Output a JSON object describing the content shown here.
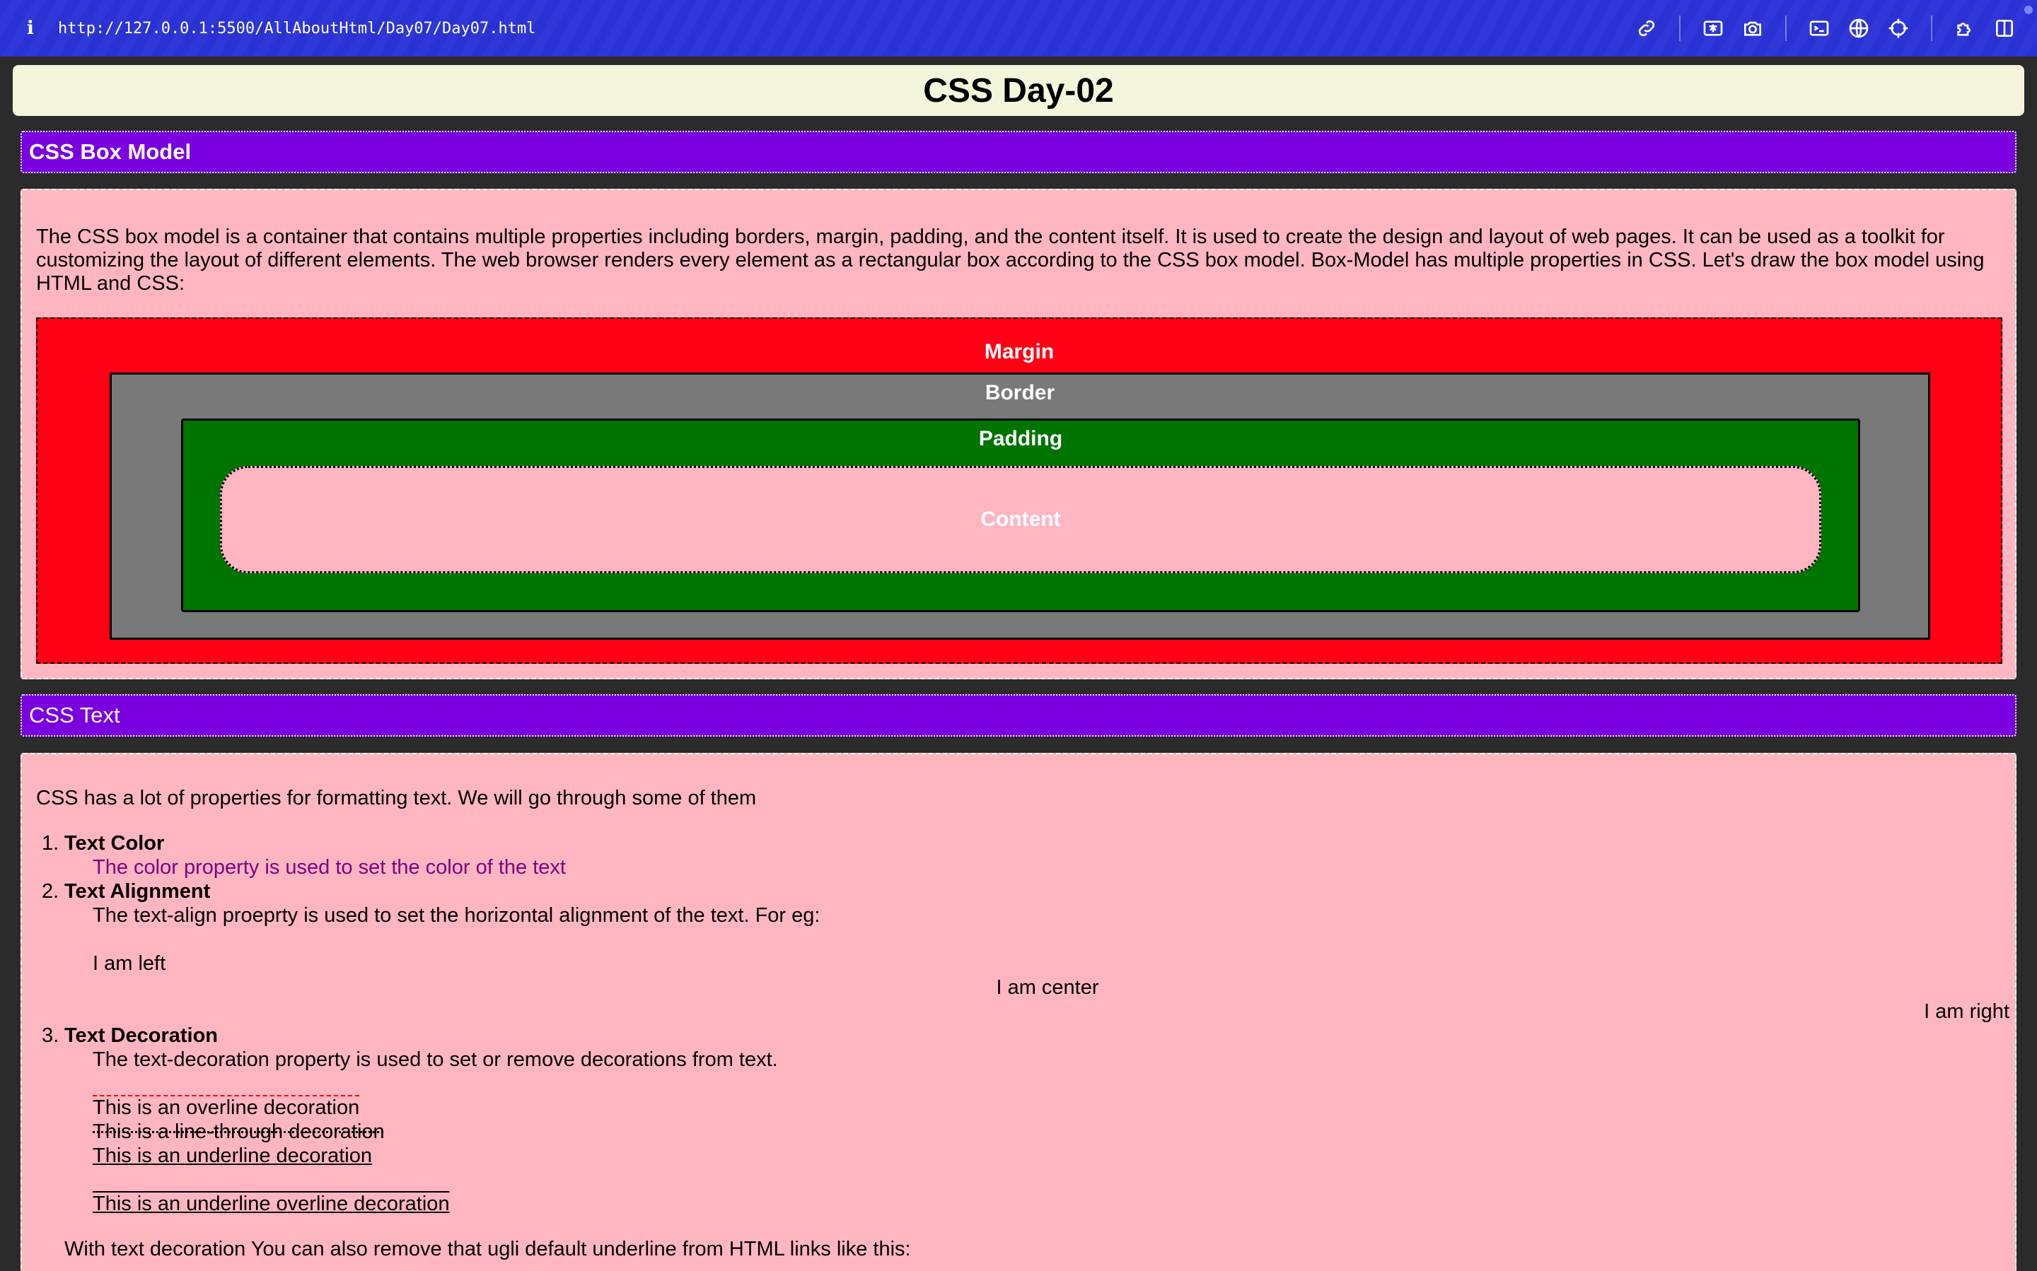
{
  "browser": {
    "url": "http://127.0.0.1:5500/AllAboutHtml/Day07/Day07.html",
    "toolbar_icons": [
      "link-icon",
      "translate-icon",
      "camera-icon",
      "terminal-icon",
      "globe-icon",
      "crosshair-icon",
      "extensions-icon",
      "sidebar-icon"
    ]
  },
  "page": {
    "title": "CSS Day-02",
    "box_model": {
      "heading": "CSS Box Model",
      "intro": "The CSS box model is a container that contains multiple properties including borders, margin, padding, and the content itself. It is used to create the design and layout of web pages. It can be used as a toolkit for customizing the layout of different elements. The web browser renders every element as a rectangular box according to the CSS box model. Box-Model has multiple properties in CSS. Let's draw the box model using HTML and CSS:",
      "margin_label": "Margin",
      "border_label": "Border",
      "padding_label": "Padding",
      "content_label": "Content"
    },
    "css_text": {
      "heading": "CSS Text",
      "intro": "CSS has a lot of properties for formatting text. We will go through some of them",
      "items": [
        {
          "number": "1.",
          "title": "Text Color",
          "desc": "The color property is used to set the color of the text"
        },
        {
          "number": "2.",
          "title": "Text Alignment",
          "desc": "The text-align proeprty is used to set the horizontal alignment of the text. For eg:",
          "left": "I am left",
          "center": "I am center",
          "right": "I am right"
        },
        {
          "number": "3.",
          "title": "Text Decoration",
          "desc": "The text-decoration property is used to set or remove decorations from text.",
          "overline": "This is an overline decoration",
          "linethrough": "This is a line-through decoration",
          "underline": "This is an underline decoration",
          "underline_overline": "This is an underline overline decoration"
        }
      ],
      "footer": "With text decoration You can also remove that ugli default underline from HTML links like this:"
    }
  },
  "colors": {
    "browser_bar": "#2a32d3",
    "title_bg": "#f5f5dc",
    "section_head": "#7a00e0",
    "section_body": "#ffb6c1",
    "margin": "#ff0015",
    "border": "#797979",
    "padding": "#007400",
    "purple_text": "#800080"
  }
}
